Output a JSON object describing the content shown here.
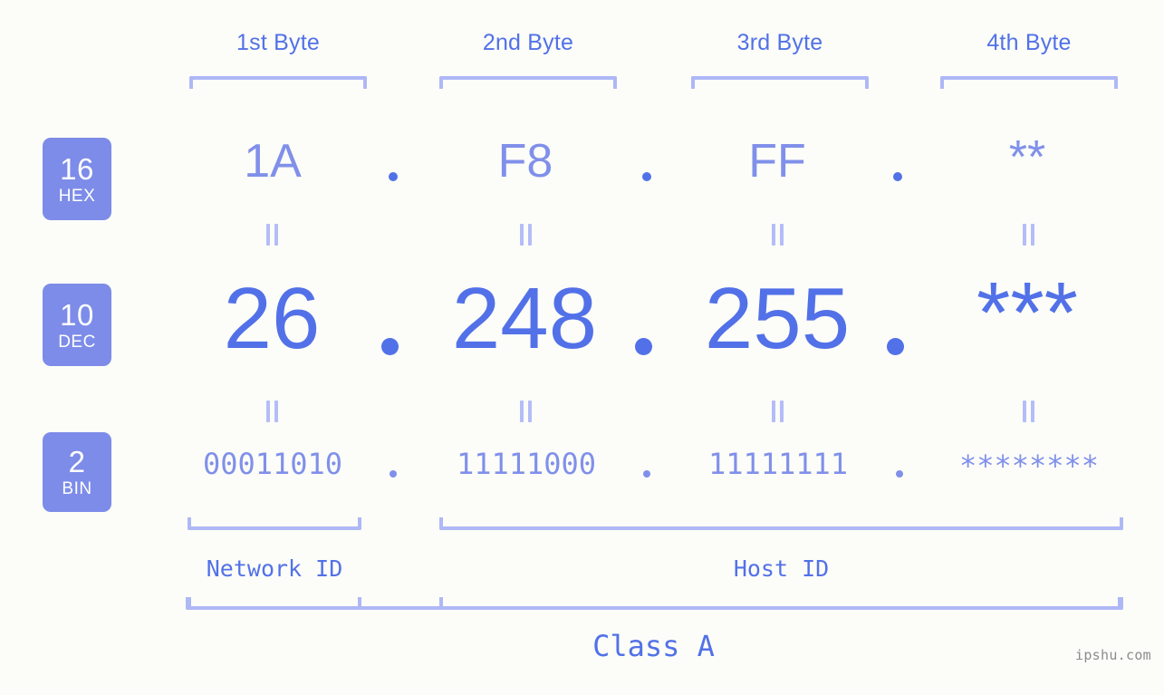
{
  "background_color": "#fcfdf8",
  "colors": {
    "accent_strong": "#5271e8",
    "accent_light": "#8090ea",
    "bracket": "#aeb8f7",
    "badge_fill": "#7d8ce8",
    "badge_text": "#ffffff",
    "watermark": "#8c8c8c"
  },
  "byte_headers": [
    {
      "label": "1st Byte"
    },
    {
      "label": "2nd Byte"
    },
    {
      "label": "3rd Byte"
    },
    {
      "label": "4th Byte"
    }
  ],
  "rows": {
    "hex": {
      "badge_number": "16",
      "badge_name": "HEX",
      "values": [
        "1A",
        "F8",
        "FF",
        "**"
      ],
      "separator": "."
    },
    "dec": {
      "badge_number": "10",
      "badge_name": "DEC",
      "values": [
        "26",
        "248",
        "255",
        "***"
      ],
      "separator": "."
    },
    "bin": {
      "badge_number": "2",
      "badge_name": "BIN",
      "values": [
        "00011010",
        "11111000",
        "11111111",
        "********"
      ],
      "separator": "."
    }
  },
  "equals_symbol": "=",
  "id_labels": {
    "network": "Network ID",
    "host": "Host ID"
  },
  "class_label": "Class A",
  "watermark": "ipshu.com"
}
